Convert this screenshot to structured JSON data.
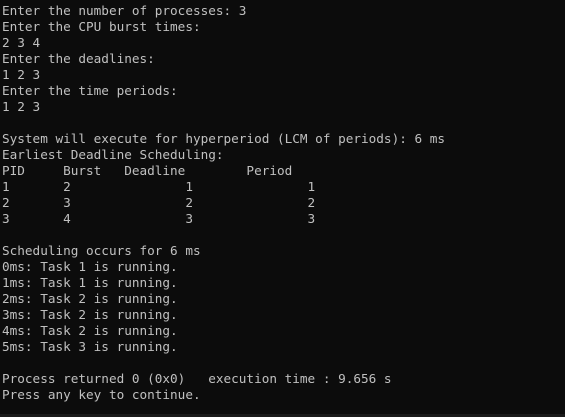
{
  "console": {
    "lines": [
      "Enter the number of processes: 3",
      "Enter the CPU burst times:",
      "2 3 4",
      "Enter the deadlines:",
      "1 2 3",
      "Enter the time periods:",
      "1 2 3",
      "",
      "System will execute for hyperperiod (LCM of periods): 6 ms",
      "Earliest Deadline Scheduling:",
      "PID     Burst   Deadline        Period",
      "1       2               1               1",
      "2       3               2               2",
      "3       4               3               3",
      "",
      "Scheduling occurs for 6 ms",
      "0ms: Task 1 is running.",
      "1ms: Task 1 is running.",
      "2ms: Task 2 is running.",
      "3ms: Task 2 is running.",
      "4ms: Task 2 is running.",
      "5ms: Task 3 is running.",
      "",
      "Process returned 0 (0x0)   execution time : 9.656 s",
      "Press any key to continue."
    ]
  },
  "colors": {
    "background": "#0c0c0c",
    "text": "#c0c0c0"
  }
}
